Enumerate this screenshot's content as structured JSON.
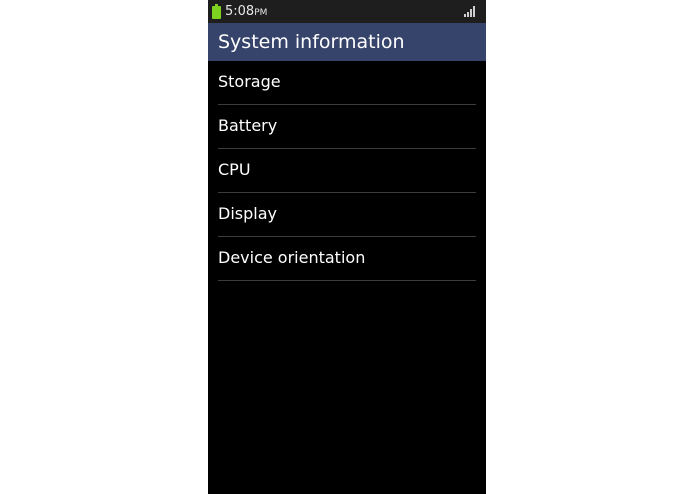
{
  "status_bar": {
    "time": "5:08",
    "ampm": "PM",
    "battery_icon": "battery-icon",
    "signal_icon": "signal-icon",
    "battery_color": "#7ed321"
  },
  "header": {
    "title": "System information",
    "background_color": "#36436a"
  },
  "list": {
    "items": [
      {
        "label": "Storage"
      },
      {
        "label": "Battery"
      },
      {
        "label": "CPU"
      },
      {
        "label": "Display"
      },
      {
        "label": "Device orientation"
      }
    ]
  }
}
